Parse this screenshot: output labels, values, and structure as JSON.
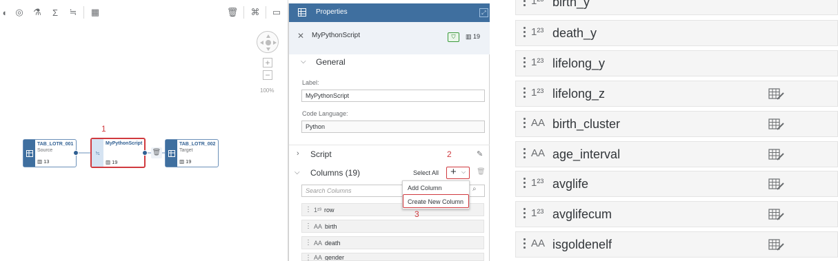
{
  "canvas": {
    "zoom_level": "100%",
    "annotations": {
      "step1": "1",
      "step2": "2",
      "step3": "3"
    },
    "nodes": [
      {
        "title": "TAB_LOTR_001",
        "subtitle": "Source",
        "count": "13"
      },
      {
        "title": "MyPythonScript",
        "subtitle": "",
        "count": "19"
      },
      {
        "title": "TAB_LOTR_002",
        "subtitle": "Target",
        "count": "19"
      }
    ]
  },
  "properties": {
    "header": "Properties",
    "object_name": "MyPythonScript",
    "column_count": "19",
    "general": {
      "title": "General",
      "label_caption": "Label:",
      "label_value": "MyPythonScript",
      "code_language_caption": "Code Language:",
      "code_language_value": "Python"
    },
    "script_title": "Script",
    "columns": {
      "title": "Columns (19)",
      "select_all": "Select All",
      "search_placeholder": "Search Columns",
      "menu": {
        "add_column": "Add Column",
        "create_new_column": "Create New Column"
      },
      "items": [
        {
          "type": "1²³",
          "name": "row"
        },
        {
          "type": "AA",
          "name": "birth"
        },
        {
          "type": "AA",
          "name": "death"
        },
        {
          "type": "AA",
          "name": "gender"
        }
      ]
    }
  },
  "zoomed_columns": [
    {
      "type": "1²³",
      "name": "birth_y",
      "editable": false
    },
    {
      "type": "1²³",
      "name": "death_y",
      "editable": false
    },
    {
      "type": "1²³",
      "name": "lifelong_y",
      "editable": false
    },
    {
      "type": "1²³",
      "name": "lifelong_z",
      "editable": true
    },
    {
      "type": "AA",
      "name": "birth_cluster",
      "editable": true
    },
    {
      "type": "AA",
      "name": "age_interval",
      "editable": true
    },
    {
      "type": "1²³",
      "name": "avglife",
      "editable": true
    },
    {
      "type": "1²³",
      "name": "avglifecum",
      "editable": true
    },
    {
      "type": "AA",
      "name": "isgoldenelf",
      "editable": true
    }
  ],
  "colors": {
    "accent": "#3f6f9f",
    "highlight": "#d0393e",
    "node_title": "#2f5f92"
  }
}
